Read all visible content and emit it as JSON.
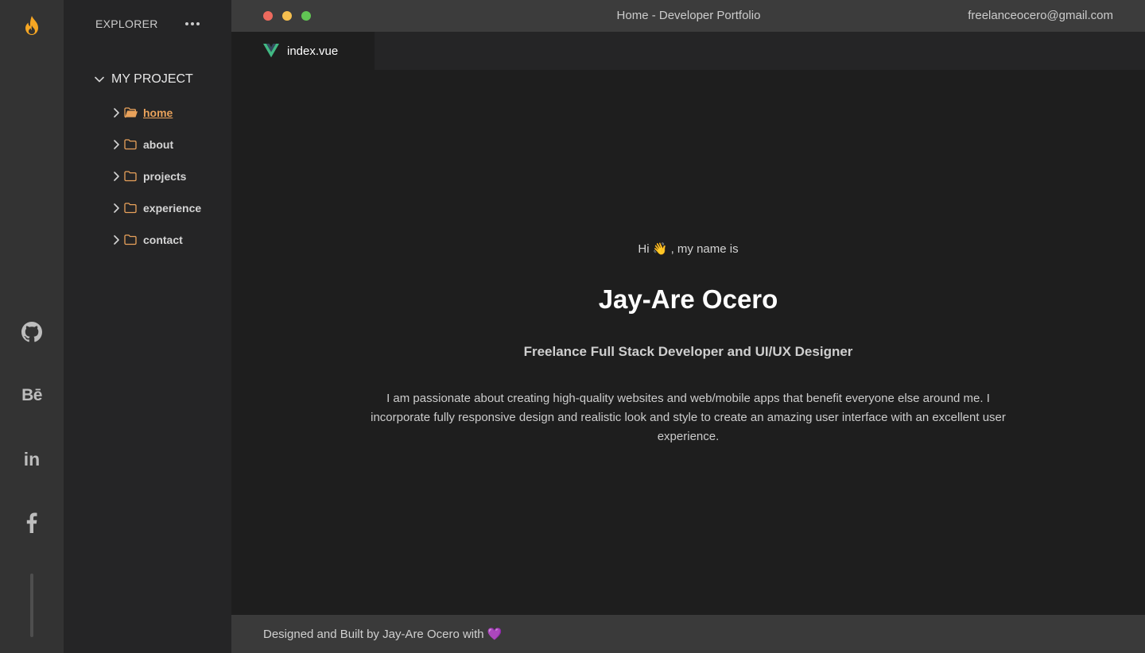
{
  "window": {
    "title": "Home - Developer Portfolio",
    "email": "freelanceocero@gmail.com"
  },
  "activity_bar": {
    "logo_icon": "flame-icon",
    "social": [
      {
        "name": "github-icon"
      },
      {
        "name": "behance-icon",
        "glyph": "Bē"
      },
      {
        "name": "linkedin-icon",
        "glyph": "in"
      },
      {
        "name": "facebook-icon"
      }
    ]
  },
  "sidebar": {
    "title": "EXPLORER",
    "project": "MY PROJECT",
    "items": [
      {
        "label": "home",
        "active": true
      },
      {
        "label": "about"
      },
      {
        "label": "projects"
      },
      {
        "label": "experience"
      },
      {
        "label": "contact"
      }
    ]
  },
  "tabs": [
    {
      "label": "index.vue",
      "icon": "vue-icon"
    }
  ],
  "hero": {
    "greeting": "Hi 👋 , my name is",
    "name": "Jay-Are Ocero",
    "role": "Freelance Full Stack Developer and UI/UX Designer",
    "bio": "I am passionate about creating high-quality websites and web/mobile apps that benefit everyone else around me. I incorporate fully responsive design and realistic look and style to create an amazing user interface with an excellent user experience."
  },
  "footer": {
    "credit": "Designed and Built by Jay-Are Ocero with 💜"
  },
  "colors": {
    "accent_orange": "#e9a25b",
    "vue_green": "#41b883",
    "folder": "#e9a25b"
  }
}
